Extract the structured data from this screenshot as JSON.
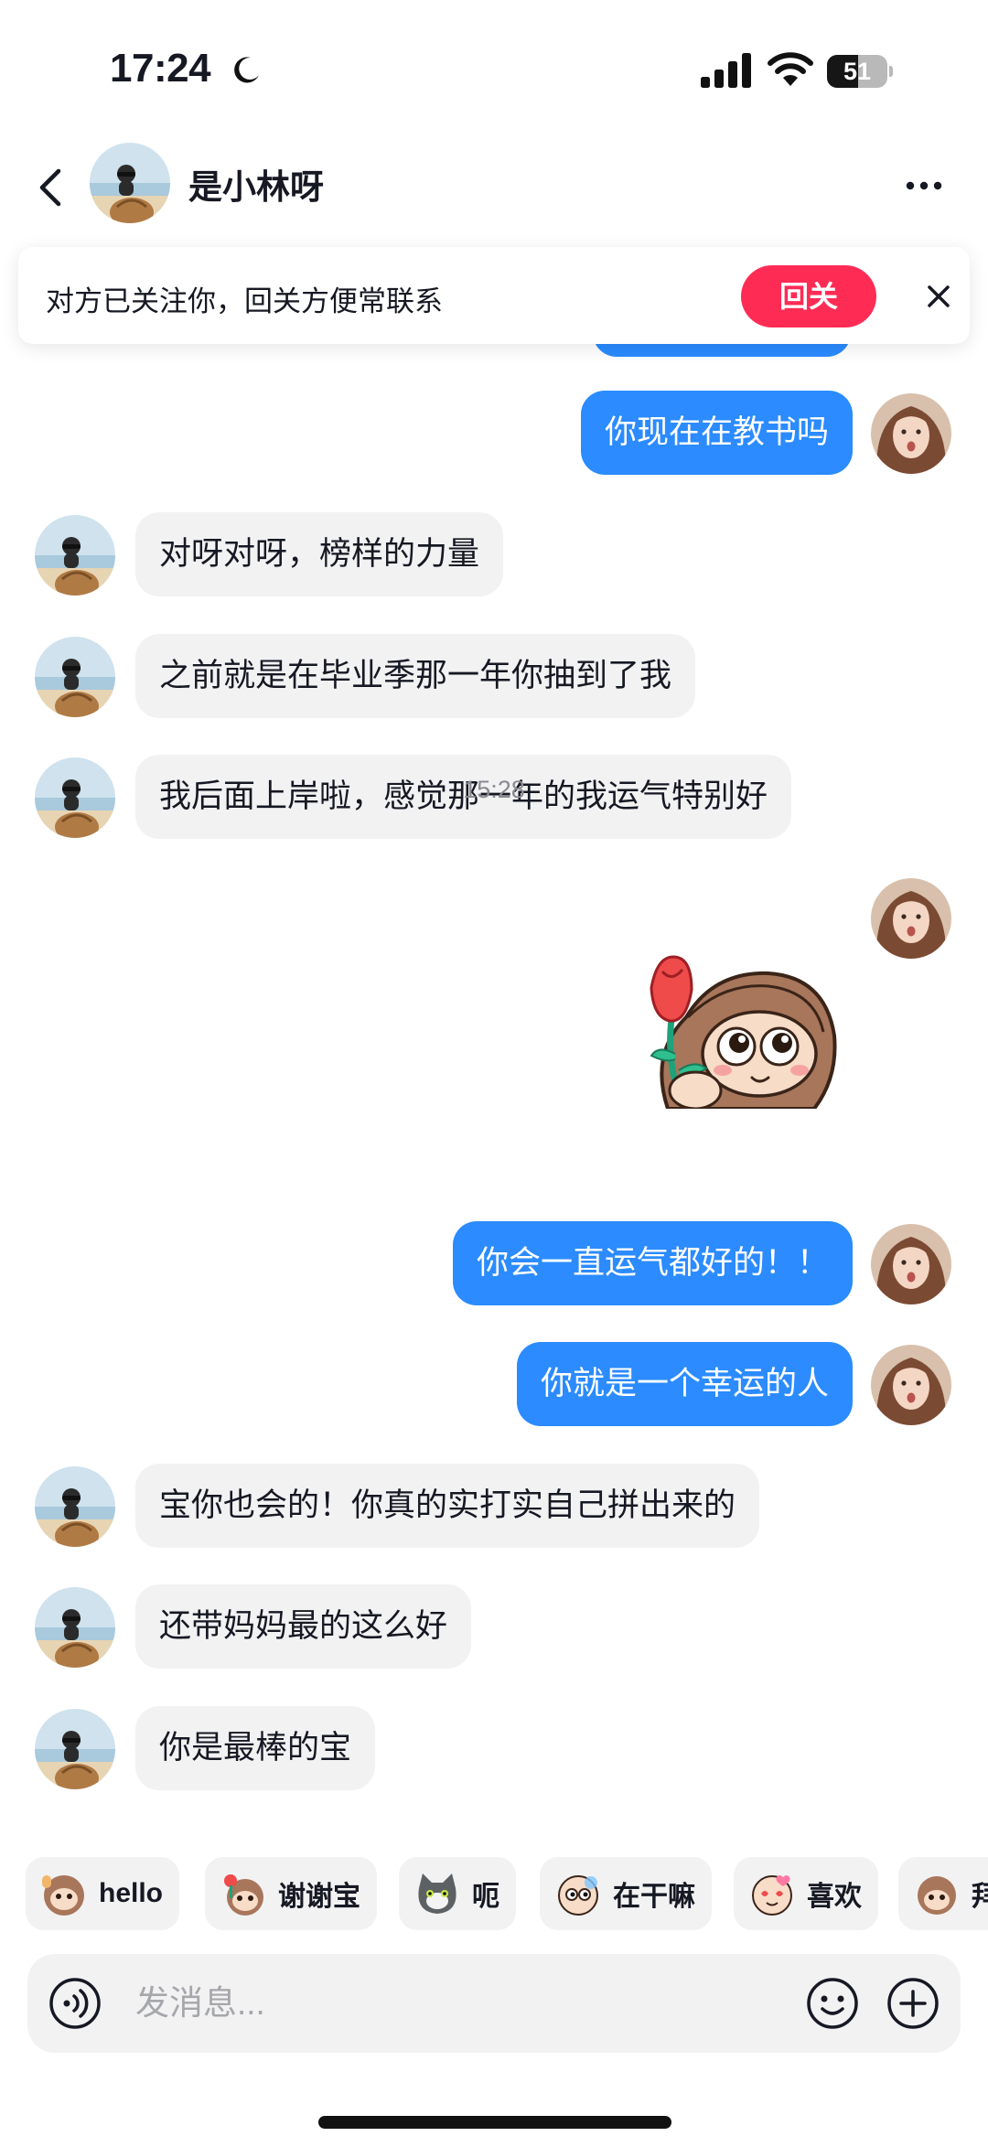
{
  "status_bar": {
    "time": "17:24",
    "battery": "51",
    "battery_level": 0.51
  },
  "header": {
    "contact_name": "是小林呀"
  },
  "follow_banner": {
    "text": "对方已关注你，回关方便常联系",
    "button_label": "回关"
  },
  "messages": [
    {
      "side": "out",
      "text": "你现在在教书吗"
    },
    {
      "side": "in",
      "text": "对呀对呀，榜样的力量"
    },
    {
      "side": "in",
      "text": "之前就是在毕业季那一年你抽到了我"
    },
    {
      "side": "in",
      "text": "我后面上岸啦，感觉那一年的我运气特别好"
    },
    {
      "side": "out",
      "type": "sticker",
      "icon": "monkey-holding-rose-sticker"
    },
    {
      "type": "time",
      "text": "15:28"
    },
    {
      "side": "out",
      "text": "你会一直运气都好的！！"
    },
    {
      "side": "out",
      "text": "你就是一个幸运的人"
    },
    {
      "side": "in",
      "text": "宝你也会的！你真的实打实自己拼出来的"
    },
    {
      "side": "in",
      "text": "还带妈妈最的这么好"
    },
    {
      "side": "in",
      "text": "你是最棒的宝"
    }
  ],
  "quick_replies": [
    {
      "label": "hello",
      "icon": "monkey-hello-icon"
    },
    {
      "label": "谢谢宝",
      "icon": "monkey-rose-icon"
    },
    {
      "label": "呃",
      "icon": "cat-icon"
    },
    {
      "label": "在干嘛",
      "icon": "peek-face-icon"
    },
    {
      "label": "喜欢",
      "icon": "heart-face-icon"
    },
    {
      "label": "拜",
      "icon": "monkey-bye-icon"
    }
  ],
  "input": {
    "placeholder": "发消息..."
  },
  "colors": {
    "outgoing_bubble": "#2b8bff",
    "incoming_bubble": "#f2f2f3",
    "follow_button": "#fe2c55"
  }
}
